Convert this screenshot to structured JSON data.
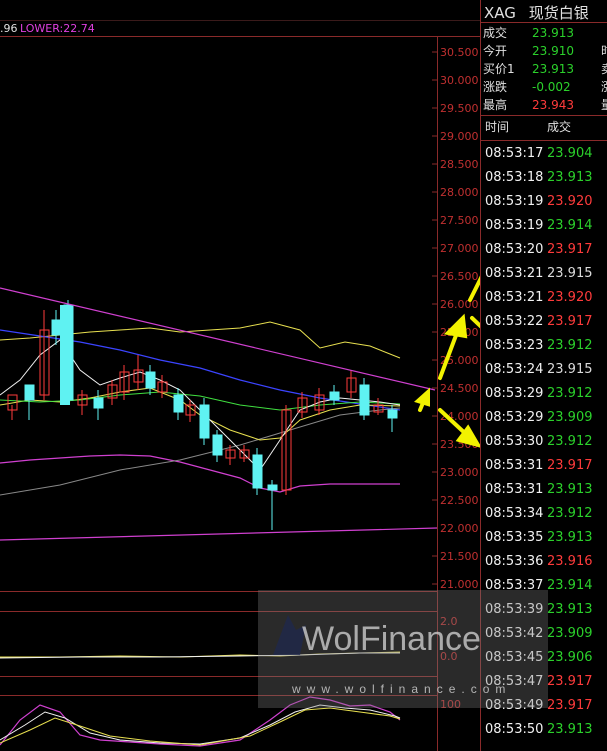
{
  "indicator_legend": {
    "left_fragment": ".96",
    "lower_label": "LOWER:22.74"
  },
  "price_axis": [
    "30.500",
    "30.000",
    "29.500",
    "29.000",
    "28.500",
    "28.000",
    "27.500",
    "27.000",
    "26.500",
    "26.000",
    "25.500",
    "25.000",
    "24.500",
    "24.000",
    "23.500",
    "23.000",
    "22.500",
    "22.000",
    "21.500",
    "21.000"
  ],
  "sub_axis": [
    "2.0",
    "0.0"
  ],
  "osc_axis": [
    "100"
  ],
  "header": {
    "symbol": "XAG",
    "name": "现货白银"
  },
  "quote": [
    {
      "label": "成交",
      "value": "23.913",
      "color": "#2bd12b",
      "extra": ""
    },
    {
      "label": "今开",
      "value": "23.910",
      "color": "#2bd12b",
      "extra": "时"
    },
    {
      "label": "买价1",
      "value": "23.913",
      "color": "#2bd12b",
      "extra": "卖"
    },
    {
      "label": "涨跌",
      "value": "-0.002",
      "color": "#2bd12b",
      "extra": "涨"
    },
    {
      "label": "最高",
      "value": "23.943",
      "color": "#ff3b3b",
      "extra": "量"
    }
  ],
  "ticks_header": {
    "time": "时间",
    "price": "成交"
  },
  "ticks": [
    {
      "time": "08:53:17",
      "price": "23.904",
      "dir": "g"
    },
    {
      "time": "08:53:18",
      "price": "23.913",
      "dir": "g"
    },
    {
      "time": "08:53:19",
      "price": "23.920",
      "dir": "r"
    },
    {
      "time": "08:53:19",
      "price": "23.914",
      "dir": "g"
    },
    {
      "time": "08:53:20",
      "price": "23.917",
      "dir": "r"
    },
    {
      "time": "08:53:21",
      "price": "23.915",
      "dir": "w"
    },
    {
      "time": "08:53:21",
      "price": "23.920",
      "dir": "r"
    },
    {
      "time": "08:53:22",
      "price": "23.917",
      "dir": "r"
    },
    {
      "time": "08:53:23",
      "price": "23.912",
      "dir": "g"
    },
    {
      "time": "08:53:24",
      "price": "23.915",
      "dir": "w"
    },
    {
      "time": "08:53:29",
      "price": "23.912",
      "dir": "g"
    },
    {
      "time": "08:53:29",
      "price": "23.909",
      "dir": "g"
    },
    {
      "time": "08:53:30",
      "price": "23.912",
      "dir": "g"
    },
    {
      "time": "08:53:31",
      "price": "23.917",
      "dir": "r"
    },
    {
      "time": "08:53:31",
      "price": "23.913",
      "dir": "g"
    },
    {
      "time": "08:53:34",
      "price": "23.912",
      "dir": "g"
    },
    {
      "time": "08:53:35",
      "price": "23.913",
      "dir": "g"
    },
    {
      "time": "08:53:36",
      "price": "23.916",
      "dir": "r"
    },
    {
      "time": "08:53:37",
      "price": "23.914",
      "dir": "g"
    },
    {
      "time": "08:53:39",
      "price": "23.913",
      "dir": "g"
    },
    {
      "time": "08:53:42",
      "price": "23.909",
      "dir": "g"
    },
    {
      "time": "08:53:45",
      "price": "23.906",
      "dir": "g"
    },
    {
      "time": "08:53:47",
      "price": "23.917",
      "dir": "r"
    },
    {
      "time": "08:53:49",
      "price": "23.917",
      "dir": "r"
    },
    {
      "time": "08:53:50",
      "price": "23.913",
      "dir": "g"
    }
  ],
  "watermark": {
    "brand": "WolFinance",
    "url": "www.wolfinance.com"
  },
  "colors": {
    "up": "#ff3b3b",
    "down": "#2bd12b",
    "candle_down": "#5ff2f2",
    "grid_border": "#8a2a2a",
    "trendline": "#d040d0",
    "arrow": "#f2f200"
  }
}
